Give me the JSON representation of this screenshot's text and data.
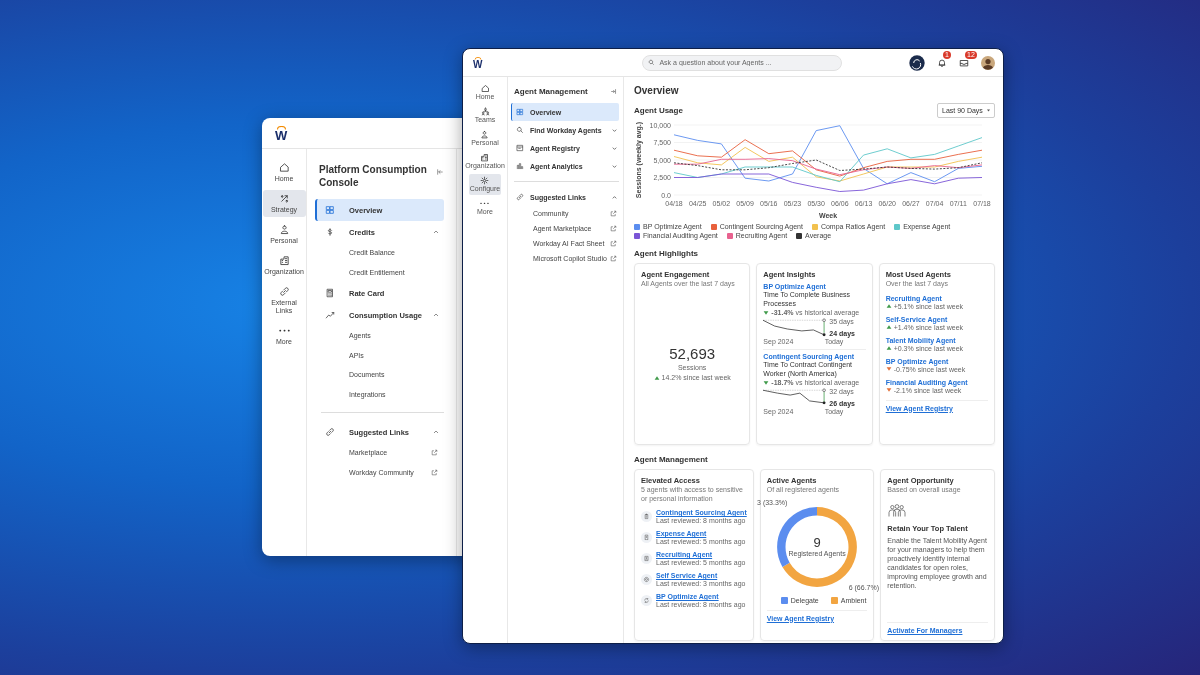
{
  "console_window": {
    "logo": "W",
    "rail": [
      {
        "label": "Home",
        "kind": "home",
        "selected": false
      },
      {
        "label": "Strategy",
        "kind": "strategy",
        "selected": true
      },
      {
        "label": "Personal",
        "kind": "person",
        "selected": false
      },
      {
        "label": "Organization",
        "kind": "building",
        "selected": false
      },
      {
        "label": "External Links",
        "kind": "link",
        "selected": false
      },
      {
        "label": "More",
        "kind": "more",
        "selected": false
      }
    ],
    "nav_title": "Platform Consumption Console",
    "nav": [
      {
        "label": "Overview",
        "kind": "grid",
        "selected": true
      },
      {
        "label": "Credits",
        "kind": "dollar",
        "selected": false,
        "expanded": true,
        "children": [
          {
            "label": "Credit Balance"
          },
          {
            "label": "Credit Entitlement"
          }
        ]
      },
      {
        "label": "Rate Card",
        "kind": "calculator",
        "selected": false
      },
      {
        "label": "Consumption Usage",
        "kind": "trend",
        "selected": false,
        "expanded": true,
        "children": [
          {
            "label": "Agents"
          },
          {
            "label": "APIs"
          },
          {
            "label": "Documents"
          },
          {
            "label": "Integrations"
          }
        ]
      }
    ],
    "suggested_links": {
      "label": "Suggested Links",
      "expanded": true,
      "items": [
        {
          "label": "Marketplace"
        },
        {
          "label": "Workday Community"
        }
      ]
    }
  },
  "agent_window": {
    "logo": "W",
    "search": {
      "placeholder": "Ask a question about your Agents ..."
    },
    "notifications": {
      "badge": "1"
    },
    "inbox": {
      "badge": "12"
    },
    "rail": [
      {
        "label": "Home",
        "kind": "home",
        "selected": false
      },
      {
        "label": "Teams",
        "kind": "teams",
        "selected": false
      },
      {
        "label": "Personal",
        "kind": "person",
        "selected": false
      },
      {
        "label": "Organization",
        "kind": "building",
        "selected": false
      },
      {
        "label": "Configure",
        "kind": "gear",
        "selected": true
      },
      {
        "label": "More",
        "kind": "more",
        "selected": false
      }
    ],
    "nav_title": "Agent Management",
    "nav": [
      {
        "label": "Overview",
        "kind": "grid",
        "selected": true
      },
      {
        "label": "Find Workday Agents",
        "kind": "search",
        "selected": false,
        "expanded": false
      },
      {
        "label": "Agent Registry",
        "kind": "registry",
        "selected": false,
        "expanded": false
      },
      {
        "label": "Agent Analytics",
        "kind": "analytics",
        "selected": false,
        "expanded": false
      }
    ],
    "suggested_links": {
      "label": "Suggested Links",
      "expanded": true,
      "items": [
        {
          "label": "Community"
        },
        {
          "label": "Agent Marketplace"
        },
        {
          "label": "Workday AI Fact Sheet"
        },
        {
          "label": "Microsoft Copilot Studio"
        }
      ]
    },
    "page_title": "Overview",
    "usage": {
      "title": "Agent Usage",
      "range": "Last 90 Days",
      "chart_data": {
        "type": "line",
        "xlabel": "Week",
        "ylabel": "Sessions (weekly avg.)",
        "categories": [
          "04/18",
          "04/25",
          "05/02",
          "05/09",
          "05/16",
          "05/23",
          "05/30",
          "06/06",
          "06/13",
          "06/20",
          "06/27",
          "07/04",
          "07/11",
          "07/18"
        ],
        "ylim": [
          0,
          10000
        ],
        "grid": true,
        "legend": true,
        "yticks": [
          {
            "value": 0,
            "label": "0.0"
          },
          {
            "value": 2500,
            "label": "2,500"
          },
          {
            "value": 5000,
            "label": "5,000"
          },
          {
            "value": 7500,
            "label": "7,500"
          },
          {
            "value": 10000,
            "label": "10,000"
          }
        ],
        "series": [
          {
            "name": "BP Optimize Agent",
            "color": "#5b8def",
            "line_style": "solid",
            "values": [
              8600,
              7800,
              7300,
              2400,
              2000,
              3000,
              9200,
              9900,
              3800,
              1600,
              3200,
              1900,
              3800,
              4100
            ]
          },
          {
            "name": "Contingent Sourcing Agent",
            "color": "#e8603c",
            "line_style": "solid",
            "values": [
              6400,
              5600,
              5400,
              7900,
              5900,
              6300,
              3600,
              2700,
              3900,
              4800,
              5100,
              5100,
              5800,
              6400
            ]
          },
          {
            "name": "Compa Ratios Agent",
            "color": "#f2c14e",
            "line_style": "solid",
            "values": [
              5500,
              4600,
              4300,
              6800,
              4800,
              5400,
              2600,
              2000,
              3000,
              4000,
              4000,
              4000,
              4800,
              5400
            ]
          },
          {
            "name": "Expense Agent",
            "color": "#5ec7c9",
            "line_style": "solid",
            "values": [
              3200,
              2500,
              3000,
              4000,
              4000,
              4000,
              2800,
              1900,
              5700,
              6600,
              5300,
              5800,
              7000,
              8200
            ]
          },
          {
            "name": "Financial Auditing Agent",
            "color": "#7b55d6",
            "line_style": "solid",
            "values": [
              2500,
              2500,
              3000,
              3000,
              3000,
              1800,
              1100,
              500,
              700,
              1600,
              2200,
              1600,
              2400,
              2500
            ]
          },
          {
            "name": "Recruiting Agent",
            "color": "#e8628f",
            "line_style": "solid",
            "values": [
              4400,
              4400,
              5100,
              5100,
              5200,
              4900,
              3700,
              2900,
              3600,
              4000,
              3800,
              4200,
              3900,
              4300
            ]
          },
          {
            "name": "Average",
            "color": "#333333",
            "line_style": "dashed",
            "values": [
              4600,
              4200,
              3600,
              3600,
              3900,
              4500,
              5000,
              3500,
              3700,
              4000,
              3800,
              3700,
              3900,
              4600
            ]
          }
        ]
      }
    },
    "highlights": {
      "title": "Agent Highlights",
      "engagement": {
        "title": "Agent Engagement",
        "subtitle": "All Agents over the last 7 days",
        "value": "52,693",
        "unit": "Sessions",
        "change": "14.2% since last week",
        "increase": true
      },
      "insights": {
        "title": "Agent Insights",
        "items": [
          {
            "agent": "BP Optimize Agent",
            "metric": "Time To Complete Business Processes",
            "change": "**-31.4%** vs historical average",
            "increase": false,
            "baseline": "35 days",
            "current": "24 days",
            "start": "Sep 2024",
            "end": "Today"
          },
          {
            "agent": "Contingent Sourcing Agent",
            "metric": "Time To Contract Contingent Worker (North America)",
            "change": "**-18.7%** vs historical average",
            "increase": false,
            "baseline": "32 days",
            "current": "26 days",
            "start": "Sep 2024",
            "end": "Today"
          }
        ]
      },
      "most_used": {
        "title": "Most Used Agents",
        "subtitle": "Over the last 7 days",
        "items": [
          {
            "agent": "Recruiting Agent",
            "change": "+5.1% since last week",
            "increase": true
          },
          {
            "agent": "Self-Service Agent",
            "change": "+1.4% since last week",
            "increase": true
          },
          {
            "agent": "Talent Mobility Agent",
            "change": "+0.3% since last week",
            "increase": true
          },
          {
            "agent": "BP Optimize Agent",
            "change": "-0.75% since last week",
            "increase": false
          },
          {
            "agent": "Financial Auditing Agent",
            "change": "-2.1% since last week",
            "increase": false
          }
        ],
        "link": "View Agent Registry"
      }
    },
    "management": {
      "title": "Agent Management",
      "elevated": {
        "title": "Elevated Access",
        "subtitle": "5 agents with access to sensitive or personal information",
        "items": [
          {
            "agent": "Contingent Sourcing Agent",
            "reviewed": "Last reviewed: 8 months ago",
            "kind": "clipboard"
          },
          {
            "agent": "Expense Agent",
            "reviewed": "Last reviewed: 5 months ago",
            "kind": "receipt"
          },
          {
            "agent": "Recruiting Agent",
            "reviewed": "Last reviewed: 5 months ago",
            "kind": "id-card"
          },
          {
            "agent": "Self Service Agent",
            "reviewed": "Last reviewed: 3 months ago",
            "kind": "target"
          },
          {
            "agent": "BP Optimize Agent",
            "reviewed": "Last reviewed: 8 months ago",
            "kind": "cycle"
          }
        ]
      },
      "active": {
        "title": "Active Agents",
        "subtitle": "Of all registered agents",
        "total": "9",
        "total_label": "Registered Agents",
        "chart_data": {
          "type": "donut",
          "categories": [
            "Delegate",
            "Ambient"
          ],
          "values": [
            3,
            6
          ],
          "colors": [
            "#5b8def",
            "#f2a541"
          ],
          "value_labels": [
            "3 (33.3%)",
            "6 (66.7%)"
          ]
        },
        "link": "View Agent Registry"
      },
      "opportunity": {
        "title": "Agent Opportunity",
        "subtitle": "Based on overall usage",
        "heading": "Retain Your Top Talent",
        "body": "Enable the Talent Mobility Agent for your managers to help them proactively identify internal candidates for open roles, improving employee growth and retention.",
        "link": "Activate For Managers"
      }
    }
  }
}
